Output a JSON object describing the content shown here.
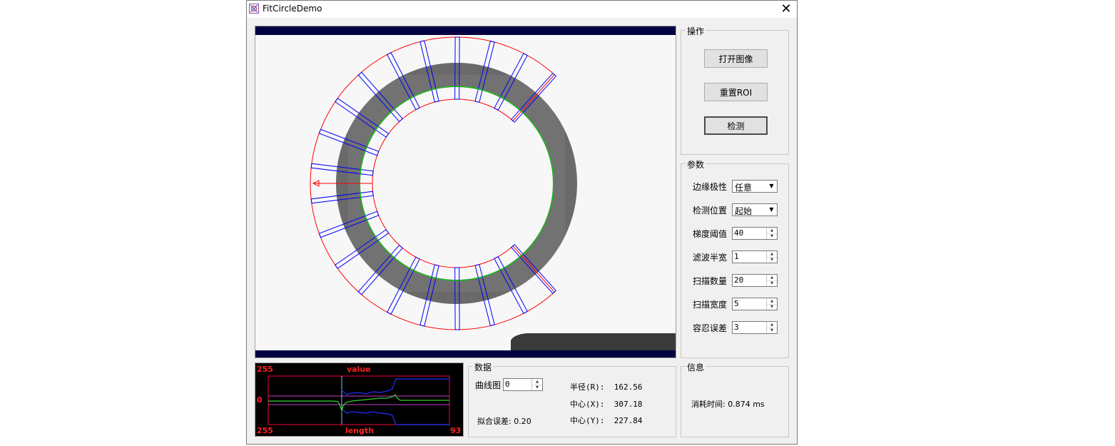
{
  "window": {
    "title": "FitCircleDemo",
    "app_icon": "app-icon",
    "close_glyph": "✕"
  },
  "operations": {
    "title": "操作",
    "open_image": "打开图像",
    "reset_roi": "重置ROI",
    "detect": "检测"
  },
  "params": {
    "title": "参数",
    "edge_polarity": {
      "label": "边缘极性",
      "value": "任意"
    },
    "detect_position": {
      "label": "检测位置",
      "value": "起始"
    },
    "gradient_threshold": {
      "label": "梯度阈值",
      "value": "40"
    },
    "filter_half_width": {
      "label": "滤波半宽",
      "value": "1"
    },
    "scan_count": {
      "label": "扫描数量",
      "value": "20"
    },
    "scan_width": {
      "label": "扫描宽度",
      "value": "5"
    },
    "tolerance": {
      "label": "容忍误差",
      "value": "3"
    }
  },
  "profile": {
    "top_left": "255",
    "top_center": "value",
    "mid_left": "0",
    "bottom_left": "255",
    "bottom_center": "length",
    "bottom_right": "93"
  },
  "data": {
    "title": "数据",
    "curve_label": "曲线图",
    "curve_value": "0",
    "fit_error": "拟合误差: 0.20",
    "radius": "半径(R):  162.56",
    "center_x": "中心(X):  307.18",
    "center_y": "中心(Y):  227.84"
  },
  "info": {
    "title": "信息",
    "elapsed": "消耗时间: 0.874 ms"
  },
  "colors": {
    "roi": "#ff0000",
    "scan_lines": "#0000ff",
    "fit_circle": "#00cc00",
    "image_band": "#000040"
  }
}
